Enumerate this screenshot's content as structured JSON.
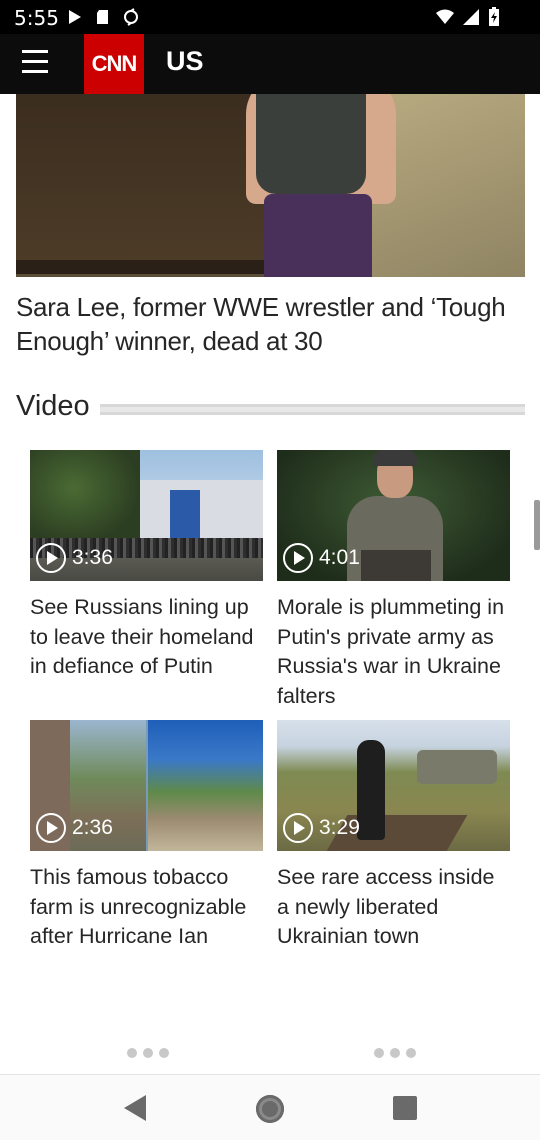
{
  "status_bar": {
    "time": "5:55",
    "left_icons": [
      "play-store-icon",
      "sd-card-icon",
      "sync-icon"
    ],
    "right_icons": [
      "wifi-icon",
      "signal-icon",
      "battery-charging-icon"
    ]
  },
  "header": {
    "menu_icon": "hamburger-menu-icon",
    "logo_text": "CNN",
    "section_title": "US"
  },
  "article": {
    "headline": "Sara Lee, former WWE wrestler and ‘Tough Enough’ winner, dead at 30"
  },
  "video_section": {
    "label": "Video",
    "cards": [
      {
        "duration": "3:36",
        "title": "See Russians lining up to leave their homeland in defiance of Putin"
      },
      {
        "duration": "4:01",
        "title": "Morale is plummeting in Putin's private army as Russia's war in Ukraine falters"
      },
      {
        "duration": "2:36",
        "title": "This famous tobacco farm is unrecognizable after Hurricane Ian"
      },
      {
        "duration": "3:29",
        "title": "See rare access inside a newly liberated Ukrainian town"
      }
    ]
  },
  "nav_bar": {
    "icons": [
      "back-icon",
      "home-icon",
      "recent-apps-icon"
    ]
  },
  "colors": {
    "brand": "#cc0000",
    "header_bg": "#0c0c0c",
    "text": "#262626"
  }
}
